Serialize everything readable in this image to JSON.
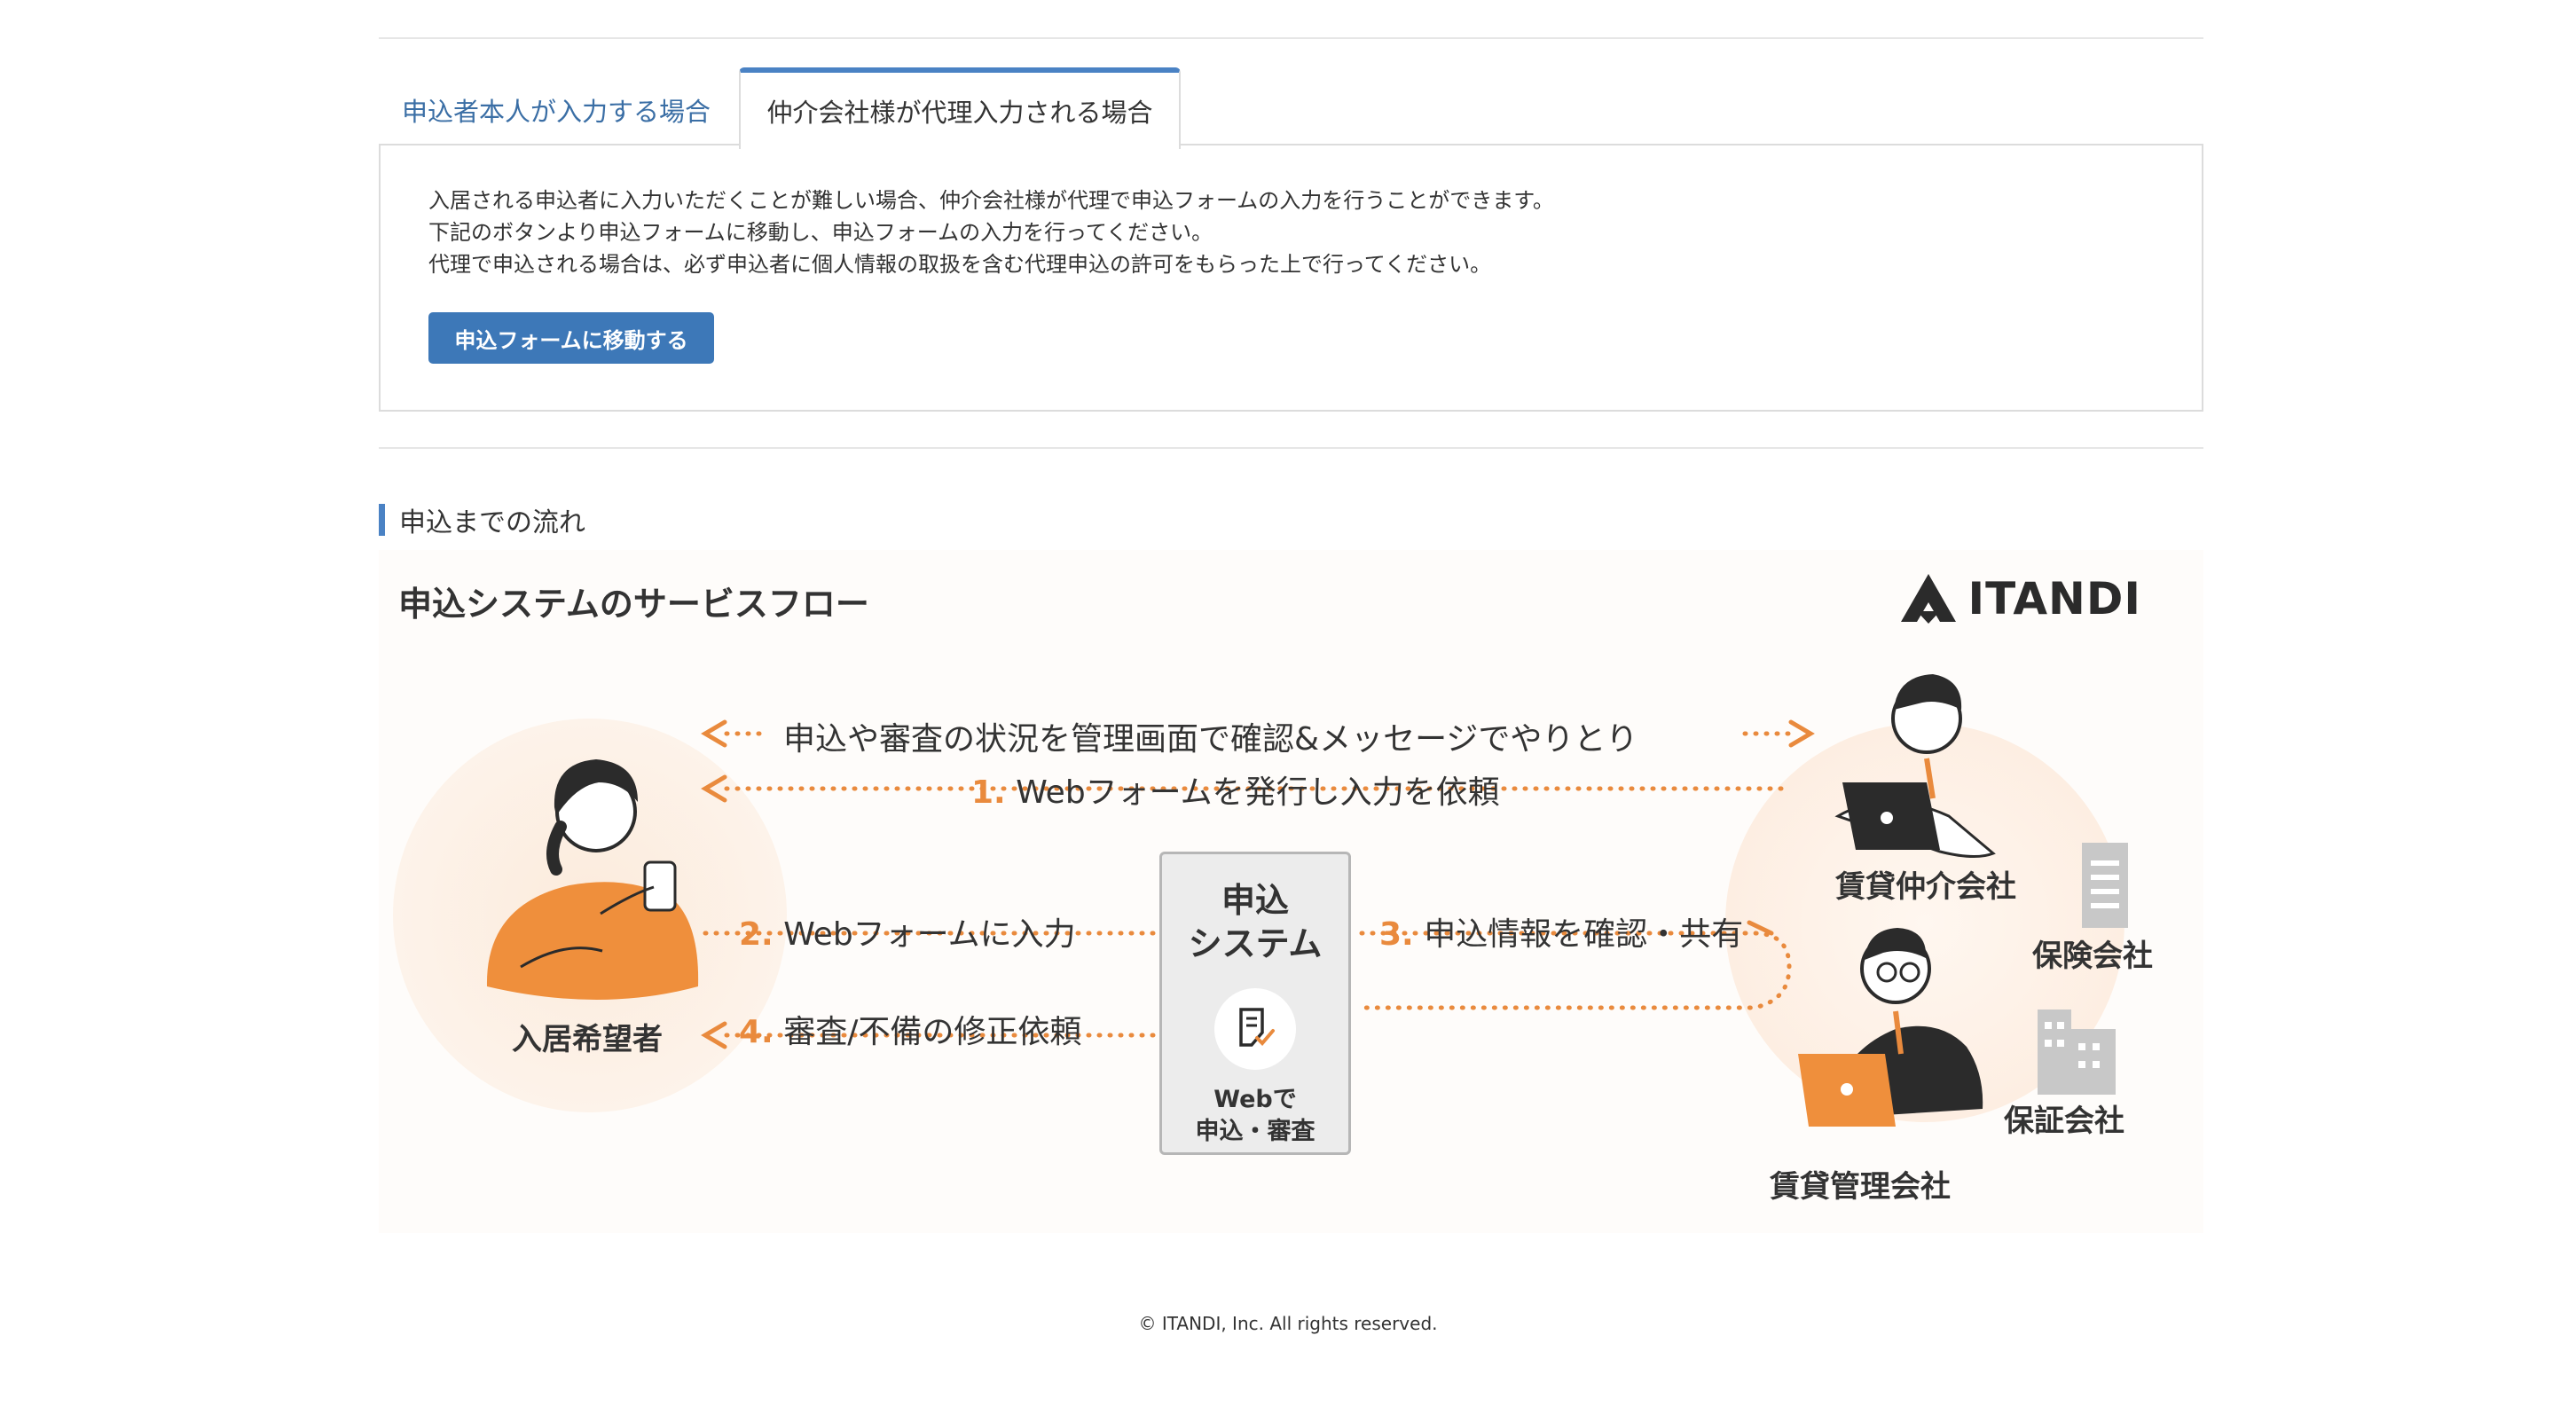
{
  "tabs": {
    "self": "申込者本人が入力する場合",
    "agent": "仲介会社様が代理入力される場合"
  },
  "panel": {
    "line1": "入居される申込者に入力いただくことが難しい場合、仲介会社様が代理で申込フォームの入力を行うことができます。",
    "line2": "下記のボタンより申込フォームに移動し、申込フォームの入力を行ってください。",
    "line3": "代理で申込される場合は、必ず申込者に個人情報の取扱を含む代理申込の許可をもらった上で行ってください。",
    "button": "申込フォームに移動する"
  },
  "section": {
    "title": "申込までの流れ"
  },
  "flow": {
    "title": "申込システムのサービスフロー",
    "logo": "ITANDI",
    "top_message": "申込や審査の状況を管理画面で確認&メッセージでやりとり",
    "step1_num": "1.",
    "step1": "Webフォームを発行し入力を依頼",
    "step2_num": "2.",
    "step2": "Webフォームに入力",
    "step3_num": "3.",
    "step3": "申込情報を確認・共有",
    "step4_num": "4.",
    "step4": "審査/不備の修正依頼",
    "center_title_1": "申込",
    "center_title_2": "システム",
    "center_sub_1": "Webで",
    "center_sub_2": "申込・審査",
    "applicant": "入居希望者",
    "broker": "賃貸仲介会社",
    "manager": "賃貸管理会社",
    "insurance": "保険会社",
    "guarantor": "保証会社"
  },
  "colors": {
    "accent": "#e98a3d",
    "brand": "#4a82c4",
    "button": "#3d78b8"
  },
  "footer": {
    "copyright": "© ITANDI, Inc. All rights reserved."
  }
}
